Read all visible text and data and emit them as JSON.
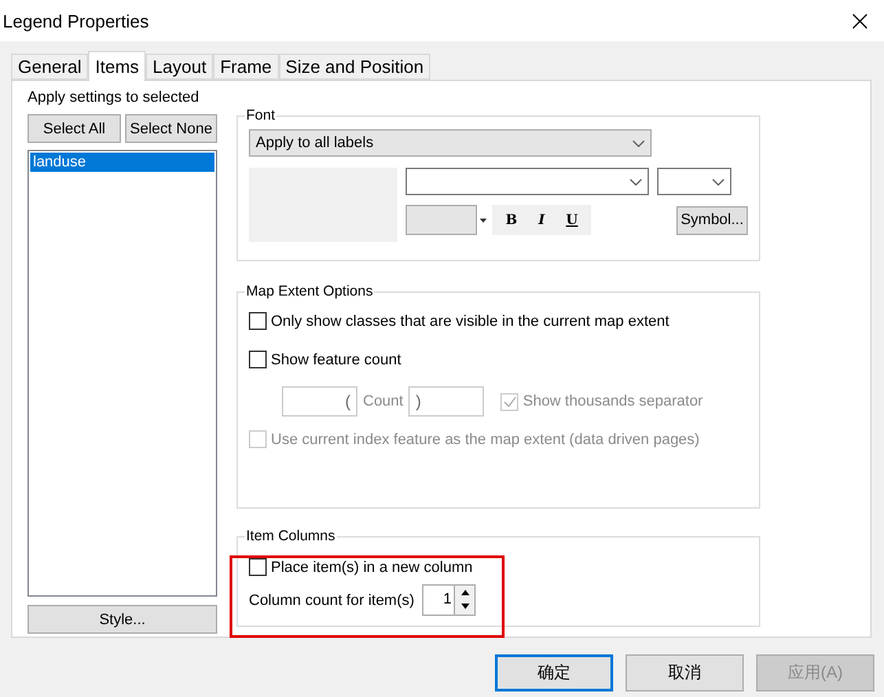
{
  "window": {
    "title": "Legend Properties"
  },
  "tabs": [
    {
      "label": "General",
      "selected": false
    },
    {
      "label": "Items",
      "selected": true
    },
    {
      "label": "Layout",
      "selected": false
    },
    {
      "label": "Frame",
      "selected": false
    },
    {
      "label": "Size and Position",
      "selected": false
    }
  ],
  "apply_label": "Apply settings to selected",
  "select_buttons": [
    "Select All",
    "Select None"
  ],
  "items": [
    {
      "label": "landuse",
      "selected": true
    }
  ],
  "style_button": "Style...",
  "font": {
    "title": "Font",
    "apply_dropdown": "Apply to all labels",
    "style_buttons": [
      "B",
      "I",
      "U"
    ],
    "symbol_button": "Symbol..."
  },
  "map_extent": {
    "title": "Map Extent Options",
    "options": [
      {
        "label": "Only show classes that are visible in the current map extent",
        "checked": false,
        "disabled": false
      },
      {
        "label": "Show feature count",
        "checked": false,
        "disabled": false
      }
    ],
    "count_prefix": "(",
    "count_label": "Count",
    "count_suffix": ")",
    "thousands": {
      "label": "Show thousands separator",
      "checked": true,
      "disabled": true
    },
    "index_option": {
      "label": "Use current index feature as the map extent (data driven pages)",
      "checked": false,
      "disabled": true
    }
  },
  "item_columns": {
    "title": "Item Columns",
    "new_column": {
      "label": "Place item(s) in a new column",
      "checked": false
    },
    "count_label": "Column count for item(s)",
    "count_value": "1"
  },
  "buttons": [
    {
      "label": "确定",
      "default": true,
      "disabled": false
    },
    {
      "label": "取消",
      "default": false,
      "disabled": false
    },
    {
      "label": "应用(A)",
      "default": false,
      "disabled": true
    }
  ]
}
